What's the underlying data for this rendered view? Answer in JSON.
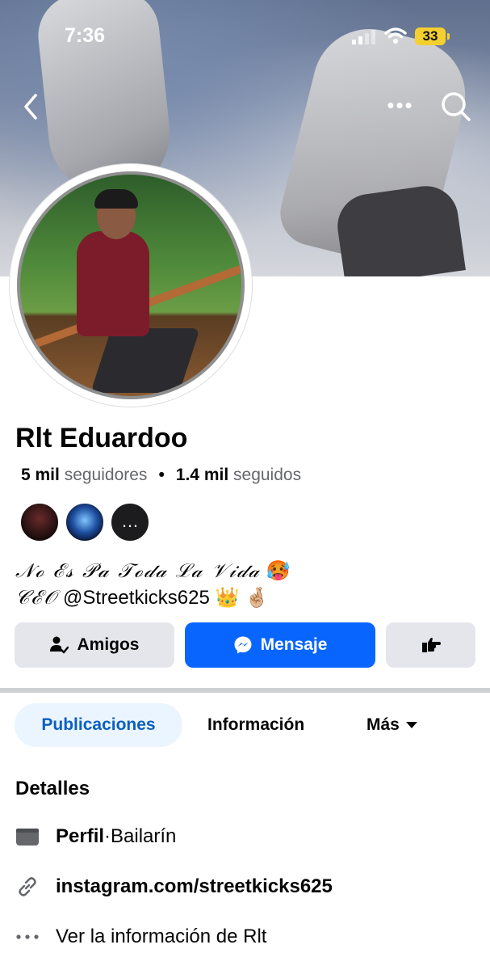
{
  "status_bar": {
    "time": "7:36",
    "battery": "33"
  },
  "profile": {
    "name": "Rlt Eduardoo",
    "followers_count": "5 mil",
    "followers_label": "seguidores",
    "separator": "•",
    "following_count": "1.4 mil",
    "following_label": "seguidos",
    "friends_more": "…",
    "bio_line1_script": "𝒩ℴ ℰ𝓈 𝒫𝒶 𝒯ℴ𝒹𝒶 ℒ𝒶 𝒱𝒾𝒹𝒶",
    "bio_line1_emoji": "🥵",
    "bio_line2_script": "𝒞ℰ𝒪",
    "bio_line2_handle": "@Streetkicks625",
    "bio_line2_emoji": "👑 🤞🏼"
  },
  "actions": {
    "friends_label": "Amigos",
    "message_label": "Mensaje"
  },
  "tabs": {
    "posts": "Publicaciones",
    "info": "Información",
    "more": "Más"
  },
  "details": {
    "title": "Detalles",
    "profile_label": "Perfil",
    "profile_sep": " · ",
    "profile_value": "Bailarín",
    "link": "instagram.com/streetkicks625",
    "see_info": "Ver la información de Rlt"
  },
  "colors": {
    "accent": "#0866ff",
    "tab_active_bg": "#ebf5ff",
    "tab_active_text": "#0b5fbf",
    "button_gray": "#e4e6eb",
    "secondary_text": "#65676b"
  }
}
